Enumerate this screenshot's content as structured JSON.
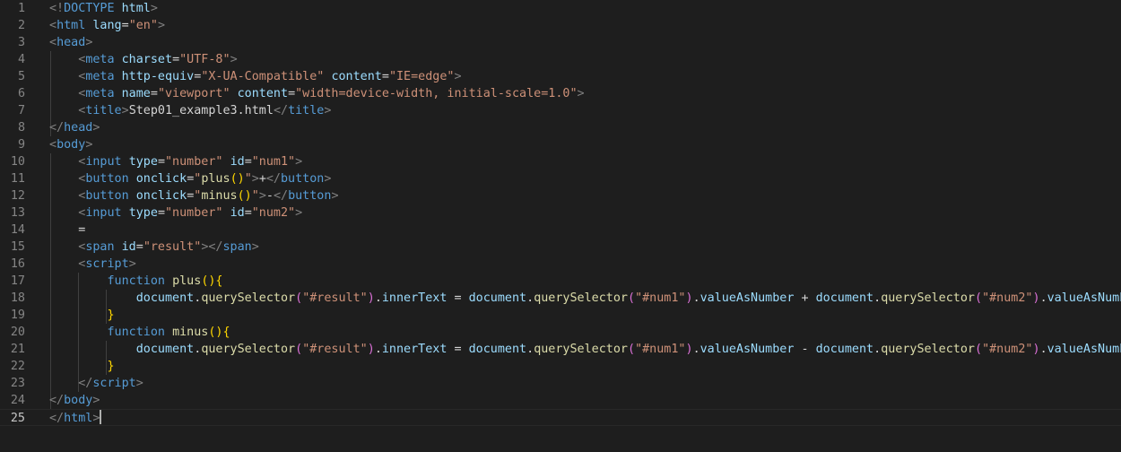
{
  "editor": {
    "theme_colors": {
      "background": "#1e1e1e",
      "tag": "#569cd6",
      "attribute": "#9cdcfe",
      "string": "#ce9178",
      "function": "#dcdcaa",
      "bracket_gold": "#ffd700",
      "bracket_pink": "#da70d6",
      "punctuation": "#808080"
    },
    "current_line": 25,
    "lines": [
      {
        "n": "1",
        "tokens": [
          [
            "br",
            "<!"
          ],
          [
            "tag",
            "DOCTYPE"
          ],
          [
            "txt",
            " "
          ],
          [
            "attr",
            "html"
          ],
          [
            "br",
            ">"
          ]
        ]
      },
      {
        "n": "2",
        "tokens": [
          [
            "br",
            "<"
          ],
          [
            "tag",
            "html"
          ],
          [
            "txt",
            " "
          ],
          [
            "attr",
            "lang"
          ],
          [
            "txt",
            "="
          ],
          [
            "str",
            "\"en\""
          ],
          [
            "br",
            ">"
          ]
        ]
      },
      {
        "n": "3",
        "tokens": [
          [
            "br",
            "<"
          ],
          [
            "tag",
            "head"
          ],
          [
            "br",
            ">"
          ]
        ]
      },
      {
        "n": "4",
        "tokens": [
          [
            "txt",
            "    "
          ],
          [
            "br",
            "<"
          ],
          [
            "tag",
            "meta"
          ],
          [
            "txt",
            " "
          ],
          [
            "attr",
            "charset"
          ],
          [
            "txt",
            "="
          ],
          [
            "str",
            "\"UTF-8\""
          ],
          [
            "br",
            ">"
          ]
        ]
      },
      {
        "n": "5",
        "tokens": [
          [
            "txt",
            "    "
          ],
          [
            "br",
            "<"
          ],
          [
            "tag",
            "meta"
          ],
          [
            "txt",
            " "
          ],
          [
            "attr",
            "http-equiv"
          ],
          [
            "txt",
            "="
          ],
          [
            "str",
            "\"X-UA-Compatible\""
          ],
          [
            "txt",
            " "
          ],
          [
            "attr",
            "content"
          ],
          [
            "txt",
            "="
          ],
          [
            "str",
            "\"IE=edge\""
          ],
          [
            "br",
            ">"
          ]
        ]
      },
      {
        "n": "6",
        "tokens": [
          [
            "txt",
            "    "
          ],
          [
            "br",
            "<"
          ],
          [
            "tag",
            "meta"
          ],
          [
            "txt",
            " "
          ],
          [
            "attr",
            "name"
          ],
          [
            "txt",
            "="
          ],
          [
            "str",
            "\"viewport\""
          ],
          [
            "txt",
            " "
          ],
          [
            "attr",
            "content"
          ],
          [
            "txt",
            "="
          ],
          [
            "str",
            "\"width=device-width, initial-scale=1.0\""
          ],
          [
            "br",
            ">"
          ]
        ]
      },
      {
        "n": "7",
        "tokens": [
          [
            "txt",
            "    "
          ],
          [
            "br",
            "<"
          ],
          [
            "tag",
            "title"
          ],
          [
            "br",
            ">"
          ],
          [
            "txt",
            "Step01_example3.html"
          ],
          [
            "br",
            "</"
          ],
          [
            "tag",
            "title"
          ],
          [
            "br",
            ">"
          ]
        ]
      },
      {
        "n": "8",
        "tokens": [
          [
            "br",
            "</"
          ],
          [
            "tag",
            "head"
          ],
          [
            "br",
            ">"
          ]
        ]
      },
      {
        "n": "9",
        "tokens": [
          [
            "br",
            "<"
          ],
          [
            "tag",
            "body"
          ],
          [
            "br",
            ">"
          ]
        ]
      },
      {
        "n": "10",
        "tokens": [
          [
            "txt",
            "    "
          ],
          [
            "br",
            "<"
          ],
          [
            "tag",
            "input"
          ],
          [
            "txt",
            " "
          ],
          [
            "attr",
            "type"
          ],
          [
            "txt",
            "="
          ],
          [
            "str",
            "\"number\""
          ],
          [
            "txt",
            " "
          ],
          [
            "attr",
            "id"
          ],
          [
            "txt",
            "="
          ],
          [
            "str",
            "\"num1\""
          ],
          [
            "br",
            ">"
          ]
        ]
      },
      {
        "n": "11",
        "tokens": [
          [
            "txt",
            "    "
          ],
          [
            "br",
            "<"
          ],
          [
            "tag",
            "button"
          ],
          [
            "txt",
            " "
          ],
          [
            "attr",
            "onclick"
          ],
          [
            "txt",
            "="
          ],
          [
            "str",
            "\""
          ],
          [
            "fn",
            "plus"
          ],
          [
            "brk1",
            "()"
          ],
          [
            "str",
            "\""
          ],
          [
            "br",
            ">"
          ],
          [
            "txt",
            "+"
          ],
          [
            "br",
            "</"
          ],
          [
            "tag",
            "button"
          ],
          [
            "br",
            ">"
          ]
        ]
      },
      {
        "n": "12",
        "tokens": [
          [
            "txt",
            "    "
          ],
          [
            "br",
            "<"
          ],
          [
            "tag",
            "button"
          ],
          [
            "txt",
            " "
          ],
          [
            "attr",
            "onclick"
          ],
          [
            "txt",
            "="
          ],
          [
            "str",
            "\""
          ],
          [
            "fn",
            "minus"
          ],
          [
            "brk1",
            "()"
          ],
          [
            "str",
            "\""
          ],
          [
            "br",
            ">"
          ],
          [
            "txt",
            "-"
          ],
          [
            "br",
            "</"
          ],
          [
            "tag",
            "button"
          ],
          [
            "br",
            ">"
          ]
        ]
      },
      {
        "n": "13",
        "tokens": [
          [
            "txt",
            "    "
          ],
          [
            "br",
            "<"
          ],
          [
            "tag",
            "input"
          ],
          [
            "txt",
            " "
          ],
          [
            "attr",
            "type"
          ],
          [
            "txt",
            "="
          ],
          [
            "str",
            "\"number\""
          ],
          [
            "txt",
            " "
          ],
          [
            "attr",
            "id"
          ],
          [
            "txt",
            "="
          ],
          [
            "str",
            "\"num2\""
          ],
          [
            "br",
            ">"
          ]
        ]
      },
      {
        "n": "14",
        "tokens": [
          [
            "txt",
            "    ="
          ]
        ]
      },
      {
        "n": "15",
        "tokens": [
          [
            "txt",
            "    "
          ],
          [
            "br",
            "<"
          ],
          [
            "tag",
            "span"
          ],
          [
            "txt",
            " "
          ],
          [
            "attr",
            "id"
          ],
          [
            "txt",
            "="
          ],
          [
            "str",
            "\"result\""
          ],
          [
            "br",
            "></"
          ],
          [
            "tag",
            "span"
          ],
          [
            "br",
            ">"
          ]
        ]
      },
      {
        "n": "16",
        "tokens": [
          [
            "txt",
            "    "
          ],
          [
            "br",
            "<"
          ],
          [
            "tag",
            "script"
          ],
          [
            "br",
            ">"
          ]
        ]
      },
      {
        "n": "17",
        "tokens": [
          [
            "txt",
            "        "
          ],
          [
            "kw",
            "function"
          ],
          [
            "txt",
            " "
          ],
          [
            "fn",
            "plus"
          ],
          [
            "brk1",
            "(){"
          ]
        ]
      },
      {
        "n": "18",
        "tokens": [
          [
            "txt",
            "            "
          ],
          [
            "var",
            "document"
          ],
          [
            "txt",
            "."
          ],
          [
            "fn",
            "querySelector"
          ],
          [
            "brk2",
            "("
          ],
          [
            "str",
            "\"#result\""
          ],
          [
            "brk2",
            ")"
          ],
          [
            "txt",
            "."
          ],
          [
            "var",
            "innerText"
          ],
          [
            "txt",
            " = "
          ],
          [
            "var",
            "document"
          ],
          [
            "txt",
            "."
          ],
          [
            "fn",
            "querySelector"
          ],
          [
            "brk2",
            "("
          ],
          [
            "str",
            "\"#num1\""
          ],
          [
            "brk2",
            ")"
          ],
          [
            "txt",
            "."
          ],
          [
            "var",
            "valueAsNumber"
          ],
          [
            "txt",
            " + "
          ],
          [
            "var",
            "document"
          ],
          [
            "txt",
            "."
          ],
          [
            "fn",
            "querySelector"
          ],
          [
            "brk2",
            "("
          ],
          [
            "str",
            "\"#num2\""
          ],
          [
            "brk2",
            ")"
          ],
          [
            "txt",
            "."
          ],
          [
            "var",
            "valueAsNumber"
          ],
          [
            "txt",
            ";"
          ]
        ]
      },
      {
        "n": "19",
        "tokens": [
          [
            "txt",
            "        "
          ],
          [
            "brk1",
            "}"
          ]
        ]
      },
      {
        "n": "20",
        "tokens": [
          [
            "txt",
            "        "
          ],
          [
            "kw",
            "function"
          ],
          [
            "txt",
            " "
          ],
          [
            "fn",
            "minus"
          ],
          [
            "brk1",
            "(){"
          ]
        ]
      },
      {
        "n": "21",
        "tokens": [
          [
            "txt",
            "            "
          ],
          [
            "var",
            "document"
          ],
          [
            "txt",
            "."
          ],
          [
            "fn",
            "querySelector"
          ],
          [
            "brk2",
            "("
          ],
          [
            "str",
            "\"#result\""
          ],
          [
            "brk2",
            ")"
          ],
          [
            "txt",
            "."
          ],
          [
            "var",
            "innerText"
          ],
          [
            "txt",
            " = "
          ],
          [
            "var",
            "document"
          ],
          [
            "txt",
            "."
          ],
          [
            "fn",
            "querySelector"
          ],
          [
            "brk2",
            "("
          ],
          [
            "str",
            "\"#num1\""
          ],
          [
            "brk2",
            ")"
          ],
          [
            "txt",
            "."
          ],
          [
            "var",
            "valueAsNumber"
          ],
          [
            "txt",
            " - "
          ],
          [
            "var",
            "document"
          ],
          [
            "txt",
            "."
          ],
          [
            "fn",
            "querySelector"
          ],
          [
            "brk2",
            "("
          ],
          [
            "str",
            "\"#num2\""
          ],
          [
            "brk2",
            ")"
          ],
          [
            "txt",
            "."
          ],
          [
            "var",
            "valueAsNumber"
          ],
          [
            "txt",
            ";"
          ]
        ]
      },
      {
        "n": "22",
        "tokens": [
          [
            "txt",
            "        "
          ],
          [
            "brk1",
            "}"
          ]
        ]
      },
      {
        "n": "23",
        "tokens": [
          [
            "txt",
            "    "
          ],
          [
            "br",
            "</"
          ],
          [
            "tag",
            "script"
          ],
          [
            "br",
            ">"
          ]
        ]
      },
      {
        "n": "24",
        "tokens": [
          [
            "br",
            "</"
          ],
          [
            "tag",
            "body"
          ],
          [
            "br",
            ">"
          ]
        ]
      },
      {
        "n": "25",
        "tokens": [
          [
            "br",
            "</"
          ],
          [
            "tag",
            "html"
          ],
          [
            "br",
            ">"
          ]
        ]
      }
    ]
  }
}
